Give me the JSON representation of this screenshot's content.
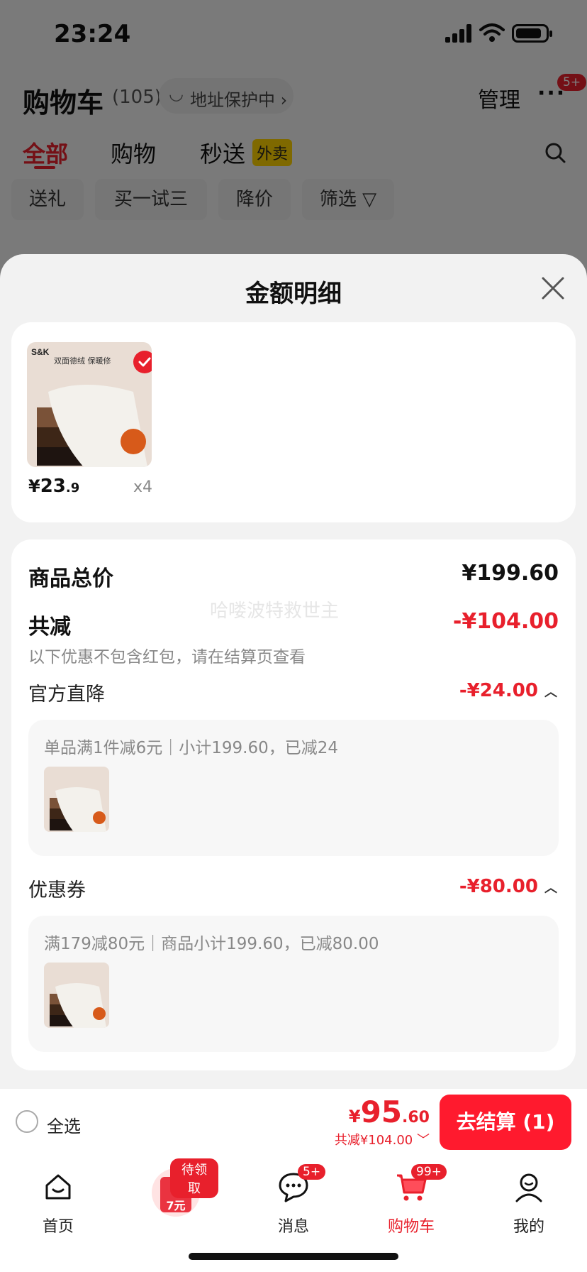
{
  "status_bar": {
    "time": "23:24"
  },
  "background": {
    "title": "购物车",
    "count": "(105)",
    "address_pill": "地址保护中 ›",
    "manage": "管理",
    "more_dots": "···",
    "more_badge": "5+",
    "tabs": [
      "全部",
      "购物",
      "秒送"
    ],
    "takeout_tag": "外卖",
    "chips": [
      "送礼",
      "买一试三",
      "降价",
      "筛选 ▽"
    ]
  },
  "sheet": {
    "title": "金额明细",
    "product": {
      "price_yen": "¥",
      "price_int": "23",
      "price_dec": ".9",
      "quantity": "x4",
      "thumb_brand": "S&K",
      "thumb_caption": "双面德绒 保暖修"
    },
    "total_goods_label": "商品总价",
    "total_goods_value": "¥199.60",
    "total_discount_label": "共减",
    "total_discount_value": "-¥104.00",
    "watermark": "哈喽波特救世主",
    "discount_note": "以下优惠不包含红包，请在结算页查看",
    "official_cut": {
      "label": "官方直降",
      "value": "-¥24.00",
      "detail": "单品满1件减6元｜小计199.60，已减24"
    },
    "coupon": {
      "label": "优惠券",
      "value": "-¥80.00",
      "detail": "满179减80元｜商品小计199.60，已减80.00"
    }
  },
  "checkout": {
    "select_all": "全选",
    "price_yen": "¥",
    "price_int": "95",
    "price_dec": ".60",
    "saved": "共减¥104.00",
    "button": "去结算 (1)"
  },
  "tabbar": {
    "items": [
      {
        "label": "首页",
        "icon": "home-icon"
      },
      {
        "label": "",
        "icon": "red-packet-icon",
        "badge": "待领取",
        "amount": "7元"
      },
      {
        "label": "消息",
        "icon": "message-icon",
        "badge": "5+"
      },
      {
        "label": "购物车",
        "icon": "cart-icon",
        "badge": "99+"
      },
      {
        "label": "我的",
        "icon": "profile-icon"
      }
    ]
  },
  "colors": {
    "accent": "#e8202c",
    "button": "#ff1a2e",
    "tag": "#ffd200"
  }
}
